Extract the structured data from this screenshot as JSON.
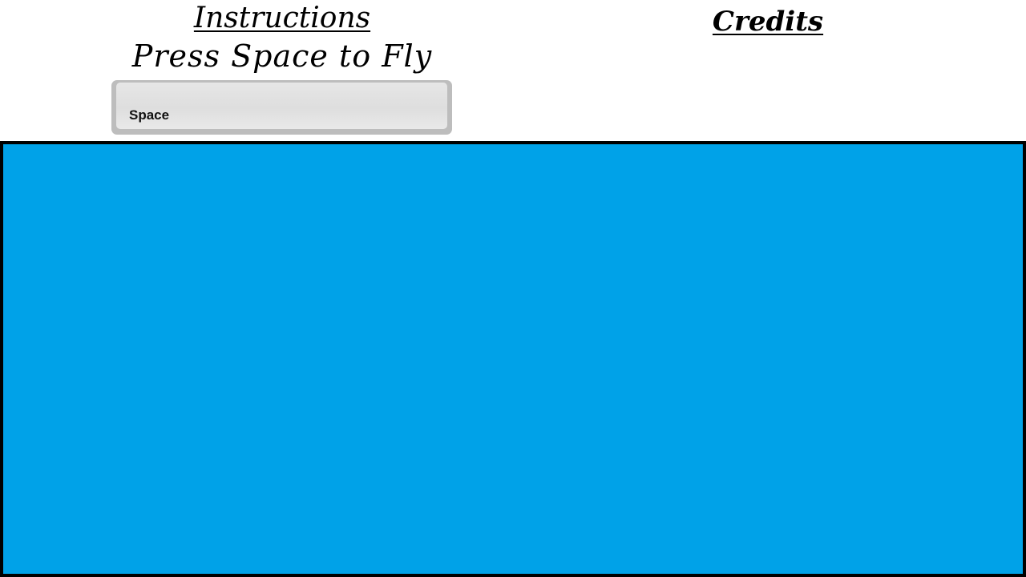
{
  "instructions": {
    "heading": "Instructions",
    "text": "Press Space to Fly",
    "key_label": "Space"
  },
  "credits": {
    "heading": "Credits"
  },
  "stage": {
    "background_color": "#00a2e8",
    "border_color": "#000000"
  }
}
